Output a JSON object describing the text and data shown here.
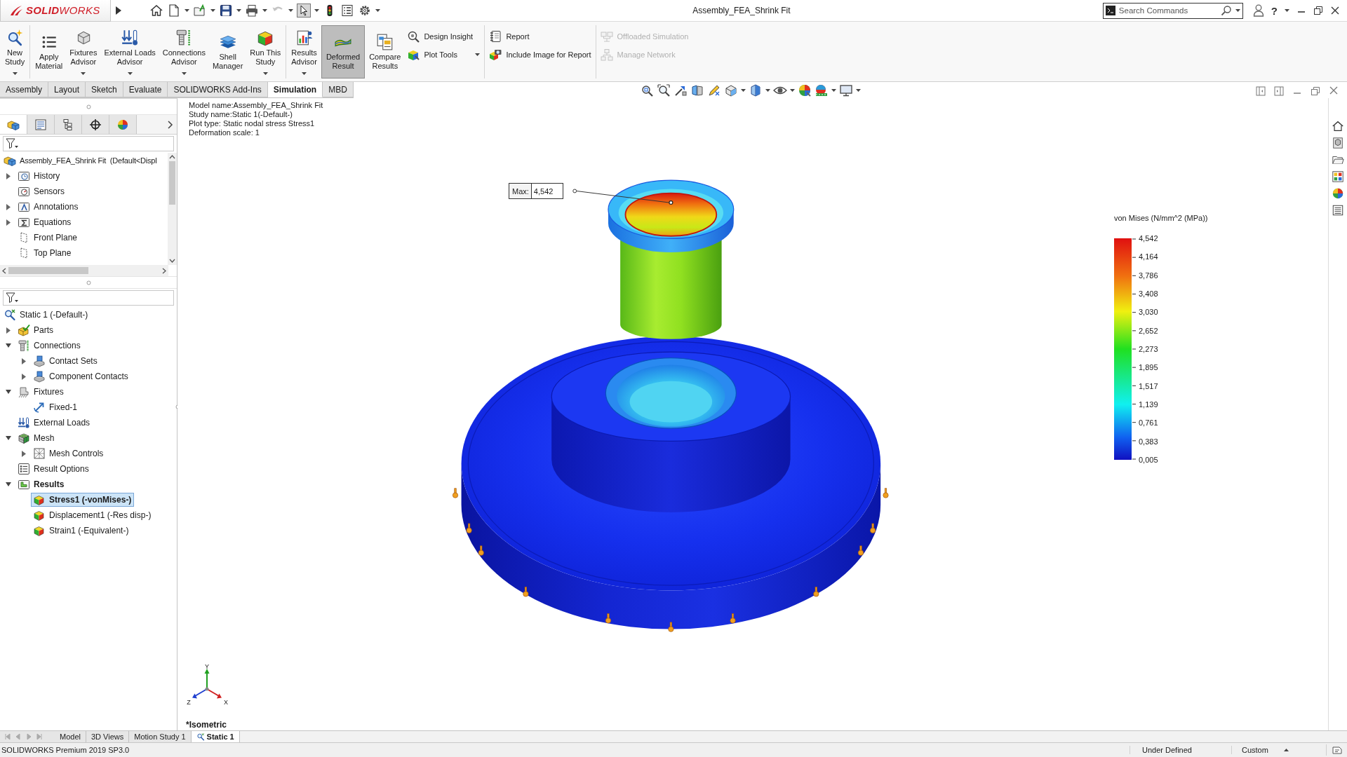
{
  "title_bar": {
    "logo": "**SOLID**WORKS",
    "title": "Assembly_FEA_Shrink Fit",
    "search": {
      "placeholder": "Search Commands"
    },
    "help": "?"
  },
  "ribbon": {
    "groups": [
      {
        "large": [
          {
            "kind": "new-study",
            "label_lines": [
              "New",
              "Study"
            ],
            "dropdown": true,
            "selected": false
          }
        ]
      },
      {
        "large": [
          {
            "kind": "apply-material",
            "label_lines": [
              "Apply",
              "Material"
            ],
            "dropdown": false,
            "selected": false
          },
          {
            "kind": "fixtures-advisor",
            "label_lines": [
              "Fixtures",
              "Advisor"
            ],
            "dropdown": true,
            "selected": false
          },
          {
            "kind": "loads-advisor",
            "label_lines": [
              "External Loads",
              "Advisor"
            ],
            "dropdown": true,
            "selected": false
          },
          {
            "kind": "connections-advisor",
            "label_lines": [
              "Connections",
              "Advisor"
            ],
            "dropdown": true,
            "selected": false
          },
          {
            "kind": "shell-manager",
            "label_lines": [
              "Shell",
              "Manager"
            ],
            "dropdown": false,
            "selected": false
          },
          {
            "kind": "run-study",
            "label_lines": [
              "Run This",
              "Study"
            ],
            "dropdown": true,
            "selected": false
          }
        ]
      },
      {
        "large": [
          {
            "kind": "results-advisor",
            "label_lines": [
              "Results",
              "Advisor"
            ],
            "dropdown": true,
            "selected": false
          },
          {
            "kind": "deformed-result",
            "label_lines": [
              "Deformed",
              "Result"
            ],
            "dropdown": false,
            "selected": true
          },
          {
            "kind": "compare-results",
            "label_lines": [
              "Compare",
              "Results"
            ],
            "dropdown": false,
            "selected": false
          }
        ],
        "small": [
          {
            "kind": "design-insight",
            "label": "Design Insight",
            "dropdown": false,
            "disabled": false
          },
          {
            "kind": "plot-tools",
            "label": "Plot Tools",
            "dropdown": true,
            "disabled": false
          }
        ]
      },
      {
        "small": [
          {
            "kind": "report",
            "label": "Report",
            "dropdown": false,
            "disabled": false
          },
          {
            "kind": "include-image",
            "label": "Include Image for Report",
            "dropdown": false,
            "disabled": false
          }
        ]
      },
      {
        "small": [
          {
            "kind": "offloaded-simulation",
            "label": "Offloaded Simulation",
            "dropdown": false,
            "disabled": true
          },
          {
            "kind": "manage-network",
            "label": "Manage Network",
            "dropdown": false,
            "disabled": true
          }
        ]
      }
    ]
  },
  "tabs": [
    {
      "label": "Assembly",
      "selected": false
    },
    {
      "label": "Layout",
      "selected": false
    },
    {
      "label": "Sketch",
      "selected": false
    },
    {
      "label": "Evaluate",
      "selected": false
    },
    {
      "label": "SOLIDWORKS Add-Ins",
      "selected": false
    },
    {
      "label": "Simulation",
      "selected": true
    },
    {
      "label": "MBD",
      "selected": false
    }
  ],
  "panel_tabs": [
    {
      "kind": "feature-manager",
      "selected": true
    },
    {
      "kind": "property-manager",
      "selected": false
    },
    {
      "kind": "configuration-manager",
      "selected": false
    },
    {
      "kind": "dimxpert",
      "selected": false
    },
    {
      "kind": "display-manager",
      "selected": false
    }
  ],
  "feature_tree": {
    "items": [
      {
        "kind": "assembly",
        "label": "Assembly_FEA_Shrink Fit  (Default<Displ",
        "selected": false,
        "active": false,
        "children": [
          {
            "kind": "history",
            "label": "History",
            "expanded": false,
            "selected": false,
            "active": false
          },
          {
            "kind": "sensors",
            "label": "Sensors",
            "selected": false,
            "active": false
          },
          {
            "kind": "annotations",
            "label": "Annotations",
            "expanded": false,
            "selected": false,
            "active": false
          },
          {
            "kind": "equations",
            "label": "Equations",
            "expanded": false,
            "selected": false,
            "active": false
          },
          {
            "kind": "plane",
            "label": "Front Plane",
            "selected": false,
            "active": false
          },
          {
            "kind": "plane",
            "label": "Top Plane",
            "selected": false,
            "active": false
          }
        ]
      }
    ]
  },
  "simulation_tree": {
    "items": [
      {
        "kind": "study",
        "label": "Static 1 (-Default-)",
        "selected": false,
        "active": false,
        "children": [
          {
            "kind": "parts",
            "label": "Parts",
            "expanded": false,
            "selected": false,
            "active": false
          },
          {
            "kind": "connections",
            "label": "Connections",
            "expanded": true,
            "selected": false,
            "active": false,
            "children": [
              {
                "kind": "contact-set",
                "label": "Contact Sets",
                "expanded": false,
                "selected": false,
                "active": false
              },
              {
                "kind": "contact-set",
                "label": "Component Contacts",
                "expanded": false,
                "selected": false,
                "active": false
              }
            ]
          },
          {
            "kind": "fixtures",
            "label": "Fixtures",
            "expanded": true,
            "selected": false,
            "active": false,
            "children": [
              {
                "kind": "fixture",
                "label": "Fixed-1",
                "selected": false,
                "active": false
              }
            ]
          },
          {
            "kind": "loads",
            "label": "External Loads",
            "selected": false,
            "active": false
          },
          {
            "kind": "mesh",
            "label": "Mesh",
            "expanded": true,
            "selected": false,
            "active": false,
            "children": [
              {
                "kind": "mesh-control",
                "label": "Mesh Controls",
                "expanded": false,
                "selected": false,
                "active": false
              }
            ]
          },
          {
            "kind": "result-options",
            "label": "Result Options",
            "selected": false,
            "active": false
          },
          {
            "kind": "results",
            "label": "Results",
            "expanded": true,
            "selected": false,
            "active": true,
            "children": [
              {
                "kind": "plot",
                "label": "Stress1 (-vonMises-)",
                "selected": true,
                "active": true
              },
              {
                "kind": "plot",
                "label": "Displacement1 (-Res disp-)",
                "selected": false,
                "active": false
              },
              {
                "kind": "plot",
                "label": "Strain1 (-Equivalent-)",
                "selected": false,
                "active": false
              }
            ]
          }
        ]
      }
    ]
  },
  "graphics": {
    "info_lines": [
      "Model name:Assembly_FEA_Shrink Fit",
      "Study name:Static 1(-Default-)",
      "Plot type: Static nodal stress Stress1",
      "Deformation scale: 1"
    ],
    "max_probe": {
      "label": "Max:",
      "value": "4,542"
    },
    "legend": {
      "title": "von Mises (N/mm^2 (MPa))",
      "labels": [
        "4,542",
        "4,164",
        "3,786",
        "3,408",
        "3,030",
        "2,652",
        "2,273",
        "1,895",
        "1,517",
        "1,139",
        "0,761",
        "0,383",
        "0,005"
      ]
    },
    "triad": {
      "y": "Y",
      "z": "Z",
      "x": "X"
    },
    "view_name": "*Isometric"
  },
  "bottom_tabs": [
    {
      "kind": "plain",
      "label": "Model",
      "selected": false
    },
    {
      "kind": "plain",
      "label": "3D Views",
      "selected": false
    },
    {
      "kind": "plain",
      "label": "Motion Study 1",
      "selected": false
    },
    {
      "kind": "study",
      "label": "Static 1",
      "selected": true
    }
  ],
  "status_bar": {
    "product": "SOLIDWORKS Premium 2019 SP3.0",
    "state": "Under Defined",
    "units": "Custom"
  }
}
